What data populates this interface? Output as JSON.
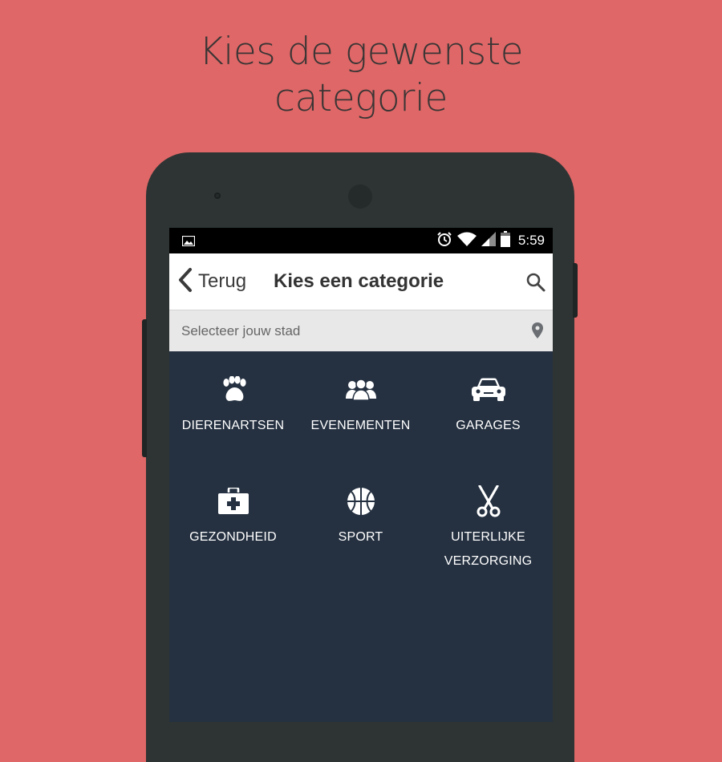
{
  "promo": {
    "line1": "Kies de gewenste",
    "line2": "categorie"
  },
  "statusbar": {
    "time": "5:59",
    "icons": [
      "image-icon",
      "alarm-icon",
      "wifi-icon",
      "signal-icon",
      "battery-icon"
    ]
  },
  "appbar": {
    "back_label": "Terug",
    "title": "Kies een categorie",
    "search_icon": "search-icon"
  },
  "city": {
    "placeholder": "Selecteer jouw stad",
    "icon": "location-pin-icon"
  },
  "categories": [
    {
      "label": "DIERENARTSEN",
      "icon": "paw-icon"
    },
    {
      "label": "EVENEMENTEN",
      "icon": "people-group-icon"
    },
    {
      "label": "GARAGES",
      "icon": "car-icon"
    },
    {
      "label": "GEZONDHEID",
      "icon": "first-aid-kit-icon"
    },
    {
      "label": "SPORT",
      "icon": "basketball-icon"
    },
    {
      "label": "UITERLIJKE VERZORGING",
      "icon": "scissors-icon"
    }
  ],
  "colors": {
    "background": "#df6767",
    "phone": "#2e3434",
    "screen": "#253141",
    "appbar": "#ffffff",
    "citybar": "#e8e8e8"
  }
}
